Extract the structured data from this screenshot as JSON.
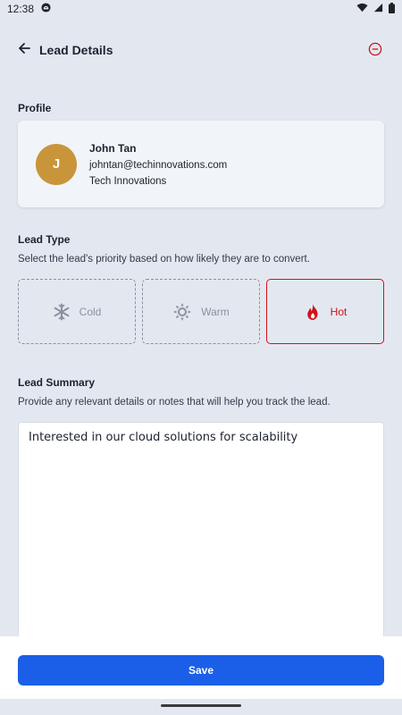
{
  "status_bar": {
    "time": "12:38",
    "icons": [
      "notification-icon",
      "wifi-icon",
      "signal-icon",
      "battery-icon"
    ]
  },
  "app_bar": {
    "title": "Lead Details",
    "back_icon": "arrow-left-icon",
    "remove_icon": "minus-circle-icon"
  },
  "profile": {
    "label": "Profile",
    "initial": "J",
    "name": "John Tan",
    "email": "johntan@techinnovations.com",
    "company": "Tech Innovations",
    "avatar_color": "#c8953a"
  },
  "lead_type": {
    "label": "Lead Type",
    "description": "Select the lead's priority based on how likely they are to convert.",
    "options": [
      {
        "label": "Cold",
        "icon": "snowflake-icon",
        "selected": false
      },
      {
        "label": "Warm",
        "icon": "sun-icon",
        "selected": false
      },
      {
        "label": "Hot",
        "icon": "flame-icon",
        "selected": true
      }
    ],
    "selected_color": "#d0121b"
  },
  "lead_summary": {
    "label": "Lead Summary",
    "description": "Provide any relevant details or notes that will help you track the lead.",
    "value": "Interested in our cloud solutions for scalability"
  },
  "save_label": "Save",
  "colors": {
    "primary": "#1b5fe8",
    "background": "#e3e8f0",
    "danger": "#d0121b"
  }
}
